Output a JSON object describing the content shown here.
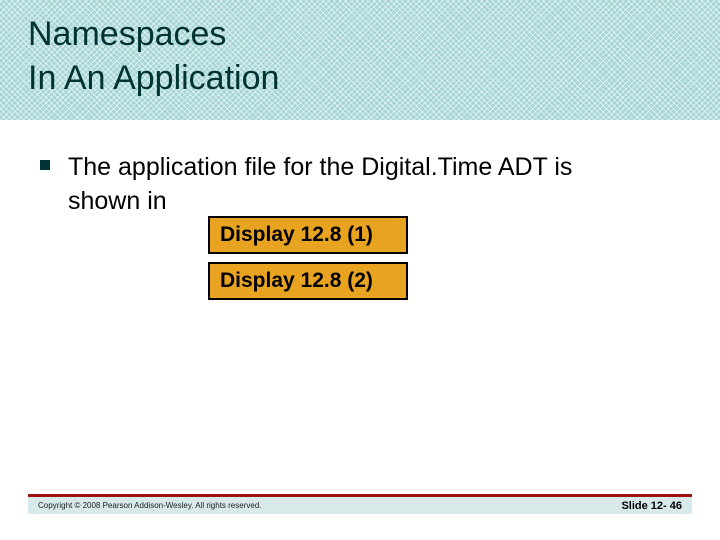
{
  "header": {
    "title_line1": "Namespaces",
    "title_line2": "In An Application"
  },
  "body": {
    "bullet1_text_a": "The application file for the Digital.Time ADT is",
    "bullet1_text_b": "shown in",
    "display_buttons": [
      {
        "label": "Display 12.8 (1)"
      },
      {
        "label": "Display 12.8 (2)"
      }
    ]
  },
  "footer": {
    "copyright": "Copyright © 2008 Pearson Addison-Wesley. All rights reserved.",
    "slide": "Slide 12- 46"
  },
  "colors": {
    "header_bg": "#a5d5d5",
    "title_color": "#003333",
    "accent_bar": "#a11111",
    "button_bg": "#e8a321"
  }
}
